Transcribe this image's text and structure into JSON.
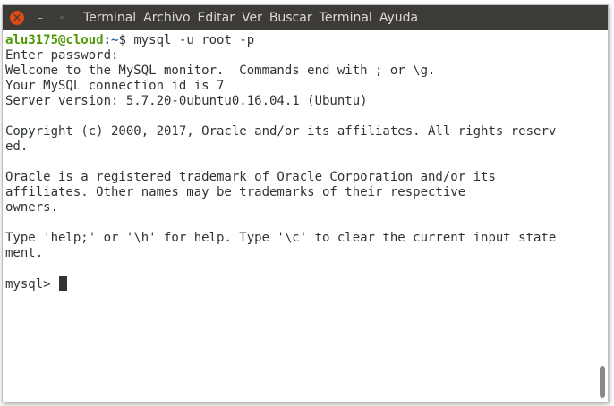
{
  "window": {
    "controls": {
      "close": "✕",
      "minimize": "–",
      "maximize": "◦"
    },
    "menu": [
      "Terminal",
      "Archivo",
      "Editar",
      "Ver",
      "Buscar",
      "Terminal",
      "Ayuda"
    ]
  },
  "terminal": {
    "prompt": {
      "user_host": "alu3175@cloud",
      "sep": ":",
      "path": "~",
      "symbol": "$ ",
      "command": "mysql -u root -p"
    },
    "lines": [
      "Enter password:",
      "Welcome to the MySQL monitor.  Commands end with ; or \\g.",
      "Your MySQL connection id is 7",
      "Server version: 5.7.20-0ubuntu0.16.04.1 (Ubuntu)",
      "",
      "Copyright (c) 2000, 2017, Oracle and/or its affiliates. All rights reserv",
      "ed.",
      "",
      "Oracle is a registered trademark of Oracle Corporation and/or its",
      "affiliates. Other names may be trademarks of their respective",
      "owners.",
      "",
      "Type 'help;' or '\\h' for help. Type '\\c' to clear the current input state",
      "ment.",
      ""
    ],
    "mysql_prompt": "mysql> "
  },
  "colors": {
    "titlebar": "#3c3b37",
    "close_button": "#df4a16",
    "menu_text": "#dfdbd2",
    "prompt_user": "#4e9a06",
    "prompt_path": "#3465a4",
    "text": "#2e3436"
  }
}
